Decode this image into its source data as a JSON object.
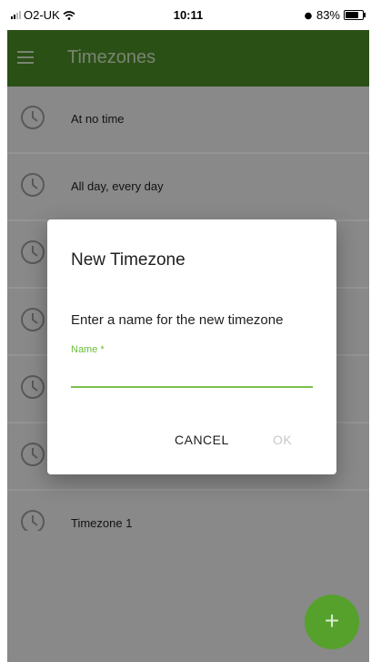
{
  "status_bar": {
    "carrier": "O2-UK",
    "time": "10:11",
    "battery": "83%"
  },
  "app_bar": {
    "title": "Timezones"
  },
  "timezones": [
    {
      "label": "At no time"
    },
    {
      "label": "All day, every day"
    },
    {
      "label": ""
    },
    {
      "label": ""
    },
    {
      "label": ""
    },
    {
      "label": ""
    },
    {
      "label": "Timezone 1"
    }
  ],
  "dialog": {
    "title": "New Timezone",
    "message": "Enter a name for the new timezone",
    "field_label": "Name *",
    "field_value": "",
    "cancel_label": "CANCEL",
    "ok_label": "OK"
  },
  "fab": {
    "label": "+"
  },
  "colors": {
    "primary": "#4a8a26",
    "accent": "#55a12c",
    "field_accent": "#7bc24c"
  }
}
